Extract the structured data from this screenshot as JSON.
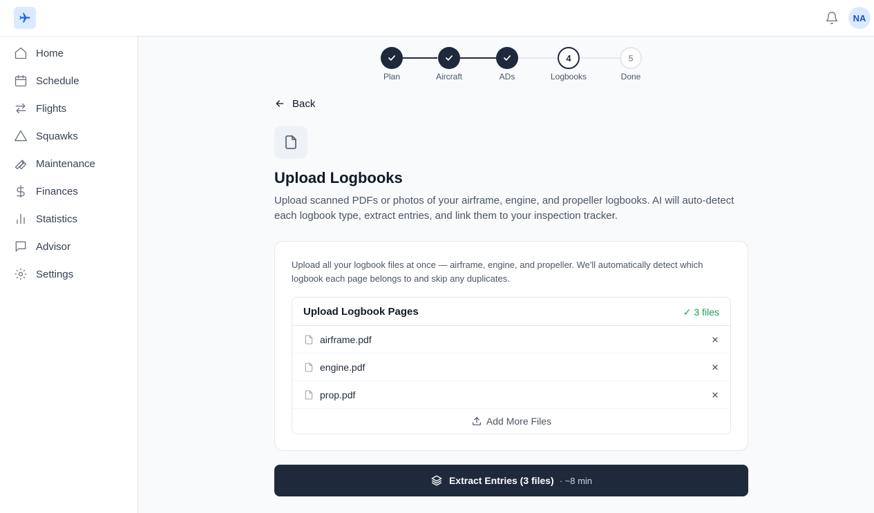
{
  "topbar": {
    "logo_icon": "airplane-icon",
    "bell_icon": "bell-icon",
    "avatar_initials": "NA"
  },
  "sidebar": {
    "items": [
      {
        "label": "Home",
        "icon": "home-icon"
      },
      {
        "label": "Schedule",
        "icon": "calendar-icon"
      },
      {
        "label": "Flights",
        "icon": "arrows-icon"
      },
      {
        "label": "Squawks",
        "icon": "warning-triangle-icon"
      },
      {
        "label": "Maintenance",
        "icon": "wrench-icon"
      },
      {
        "label": "Finances",
        "icon": "dollar-icon"
      },
      {
        "label": "Statistics",
        "icon": "bar-chart-icon"
      },
      {
        "label": "Advisor",
        "icon": "chat-icon"
      },
      {
        "label": "Settings",
        "icon": "gear-icon"
      }
    ]
  },
  "stepper": {
    "steps": [
      {
        "label": "Plan",
        "state": "done"
      },
      {
        "label": "Aircraft",
        "state": "done"
      },
      {
        "label": "ADs",
        "state": "done"
      },
      {
        "label": "Logbooks",
        "state": "current",
        "number": "4"
      },
      {
        "label": "Done",
        "state": "future",
        "number": "5"
      }
    ]
  },
  "main": {
    "back_label": "Back",
    "title": "Upload Logbooks",
    "description": "Upload scanned PDFs or photos of your airframe, engine, and propeller logbooks. AI will auto-detect each logbook type, extract entries, and link them to your inspection tracker.",
    "card": {
      "intro": "Upload all your logbook files at once — airframe, engine, and propeller. We'll automatically detect which logbook each page belongs to and skip any duplicates.",
      "upload_title": "Upload Logbook Pages",
      "files_count": "✓ 3 files",
      "files": [
        "airframe.pdf",
        "engine.pdf",
        "prop.pdf"
      ],
      "add_more_label": "Add More Files"
    },
    "extract_button": {
      "label": "Extract Entries (3 files)",
      "meta": "· ~8 min"
    }
  },
  "colors": {
    "primary_dark": "#1e293b",
    "accent_blue": "#1d4ed8",
    "success_green": "#16a34a"
  }
}
